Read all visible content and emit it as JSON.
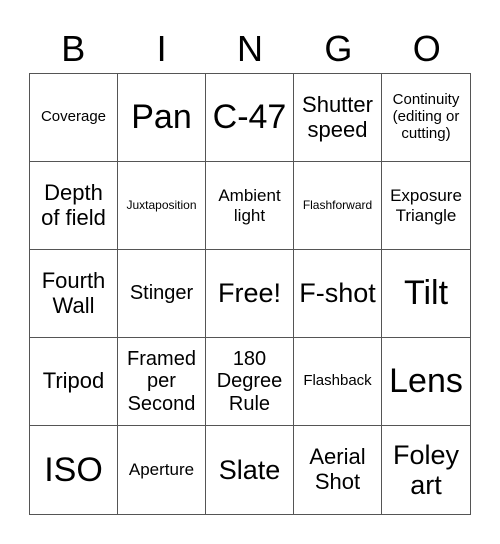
{
  "header": [
    "B",
    "I",
    "N",
    "G",
    "O"
  ],
  "cells": [
    [
      "Coverage",
      "Pan",
      "C-47",
      "Shutter speed",
      "Continuity (editing or cutting)"
    ],
    [
      "Depth of field",
      "Juxtaposition",
      "Ambient light",
      "Flashforward",
      "Exposure Triangle"
    ],
    [
      "Fourth Wall",
      "Stinger",
      "Free!",
      "F-shot",
      "Tilt"
    ],
    [
      "Tripod",
      "Framed per Second",
      "180 Degree Rule",
      "Flashback",
      "Lens"
    ],
    [
      "ISO",
      "Aperture",
      "Slate",
      "Aerial Shot",
      "Foley art"
    ]
  ]
}
